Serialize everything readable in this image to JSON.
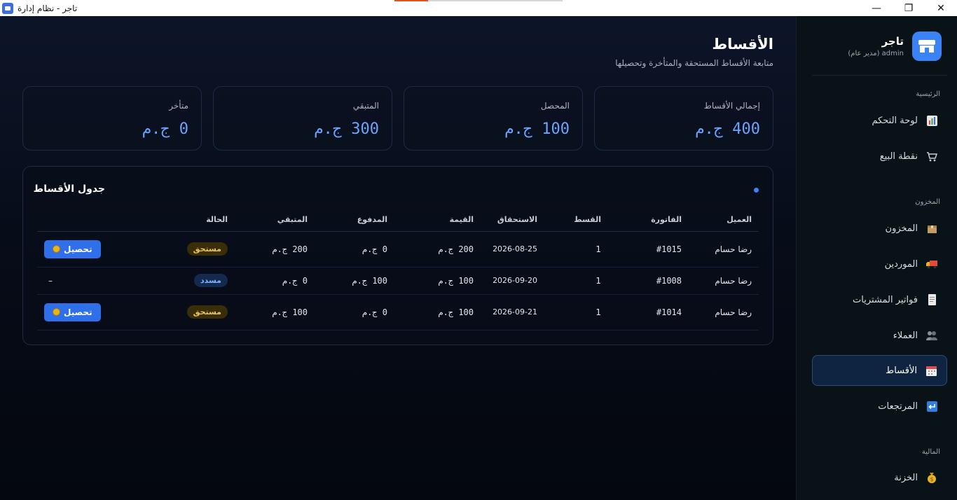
{
  "window": {
    "title": "تاجر - نظام إدارة",
    "minimize": "—",
    "maximize": "❐",
    "close": "✕"
  },
  "page": {
    "title": "الأقساط",
    "subtitle": "متابعة الأقساط المستحقة والمتأخرة وتحصيلها"
  },
  "stats": [
    {
      "label": "إجمالي الأقساط",
      "value": "400 ج.م"
    },
    {
      "label": "المحصل",
      "value": "100 ج.م"
    },
    {
      "label": "المتبقي",
      "value": "300 ج.م"
    },
    {
      "label": "متأخر",
      "value": "0 ج.م"
    }
  ],
  "table": {
    "title": "جدول الأقساط",
    "columns": [
      "العميل",
      "الفاتورة",
      "القسط",
      "الاستحقاق",
      "القيمة",
      "المدفوع",
      "المتبقي",
      "الحالة",
      ""
    ],
    "rows": [
      {
        "customer": "رضا حسام",
        "invoice": "#1015",
        "installment": "1",
        "due": "2026-08-25",
        "amount": "200 ج.م",
        "paid": "0 ج.م",
        "remaining": "200 ج.م",
        "status": "مستحق",
        "action": "تحصيل"
      },
      {
        "customer": "رضا حسام",
        "invoice": "#1008",
        "installment": "1",
        "due": "2026-09-20",
        "amount": "100 ج.م",
        "paid": "100 ج.م",
        "remaining": "0 ج.م",
        "status": "مسدد",
        "action": "–"
      },
      {
        "customer": "رضا حسام",
        "invoice": "#1014",
        "installment": "1",
        "due": "2026-09-21",
        "amount": "100 ج.م",
        "paid": "0 ج.م",
        "remaining": "100 ج.م",
        "status": "مستحق",
        "action": "تحصيل"
      }
    ]
  },
  "sidebar": {
    "brand": {
      "name": "تاجر",
      "role": "admin (مدير عام)"
    },
    "sections": {
      "main": "الرئيسية",
      "inventory": "المخزون",
      "finance": "المالية"
    },
    "items": [
      {
        "label": "لوحة التحكم",
        "icon": "chart-icon"
      },
      {
        "label": "نقطة البيع",
        "icon": "cart-icon"
      },
      {
        "label": "المخزون",
        "icon": "box-icon"
      },
      {
        "label": "الموردين",
        "icon": "truck-icon"
      },
      {
        "label": "فواتير المشتريات",
        "icon": "receipt-icon"
      },
      {
        "label": "العملاء",
        "icon": "users-icon"
      },
      {
        "label": "الأقساط",
        "icon": "calendar-icon"
      },
      {
        "label": "المرتجعات",
        "icon": "return-icon"
      },
      {
        "label": "الخزنة",
        "icon": "moneybag-icon"
      }
    ]
  },
  "colors": {
    "accent": "#3b82f6",
    "value": "#6aa5ff",
    "due": "#e9c45a",
    "paid": "#7fb0ff"
  }
}
